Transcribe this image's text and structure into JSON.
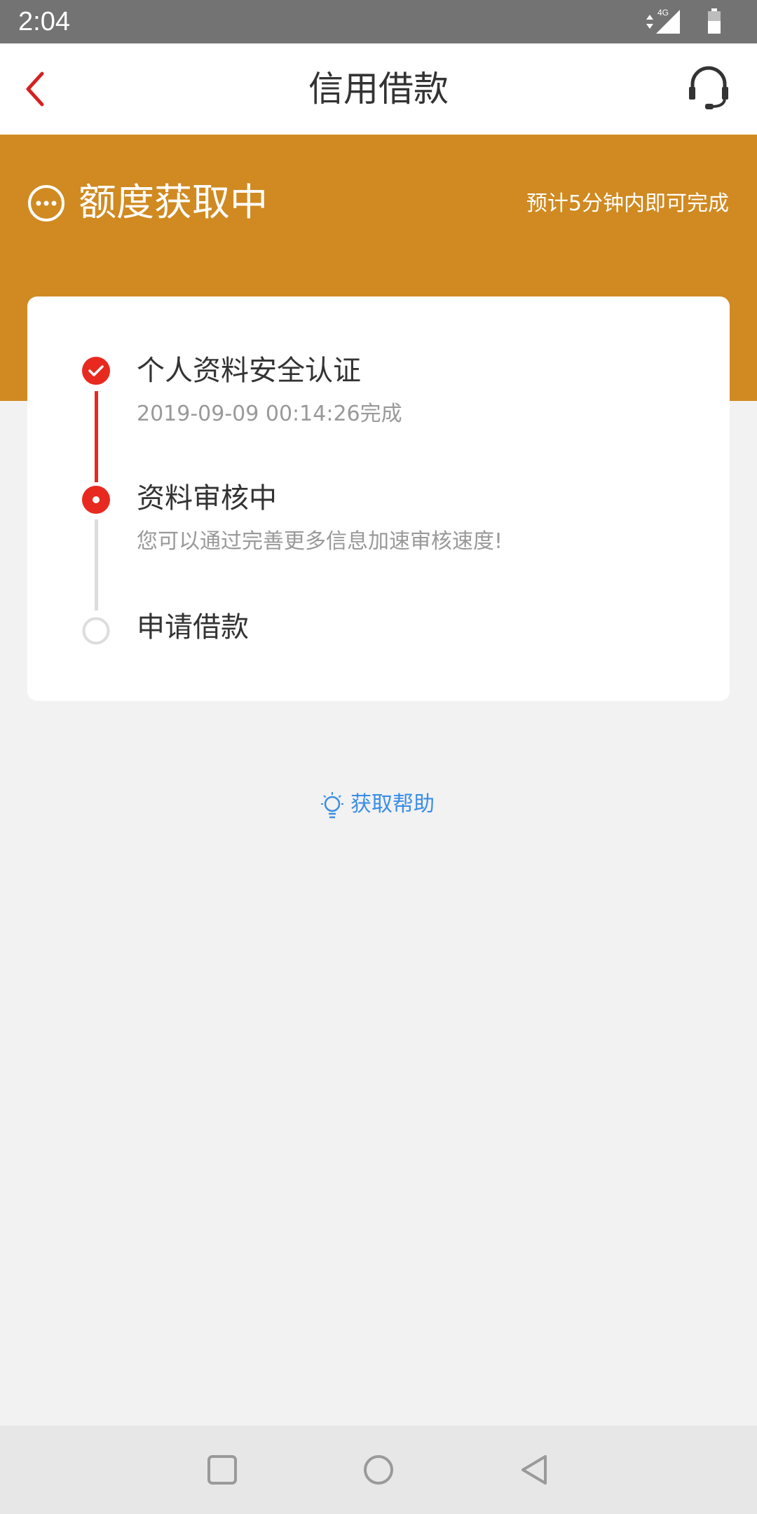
{
  "status_bar": {
    "time": "2:04",
    "network": "4G"
  },
  "app_bar": {
    "title": "信用借款",
    "back_icon": "chevron-left-icon",
    "support_icon": "headset-icon"
  },
  "banner": {
    "status": "额度获取中",
    "note": "预计5分钟内即可完成",
    "icon": "more-circle-icon"
  },
  "steps": [
    {
      "title": "个人资料安全认证",
      "subtitle": "2019-09-09 00:14:26完成",
      "state": "done"
    },
    {
      "title": "资料审核中",
      "subtitle": "您可以通过完善更多信息加速审核速度!",
      "state": "active"
    },
    {
      "title": "申请借款",
      "subtitle": "",
      "state": "pending"
    }
  ],
  "help": {
    "label": "获取帮助",
    "icon": "lightbulb-icon"
  },
  "colors": {
    "accent": "#d08a21",
    "red": "#e8291f",
    "link": "#3a8ee6"
  }
}
